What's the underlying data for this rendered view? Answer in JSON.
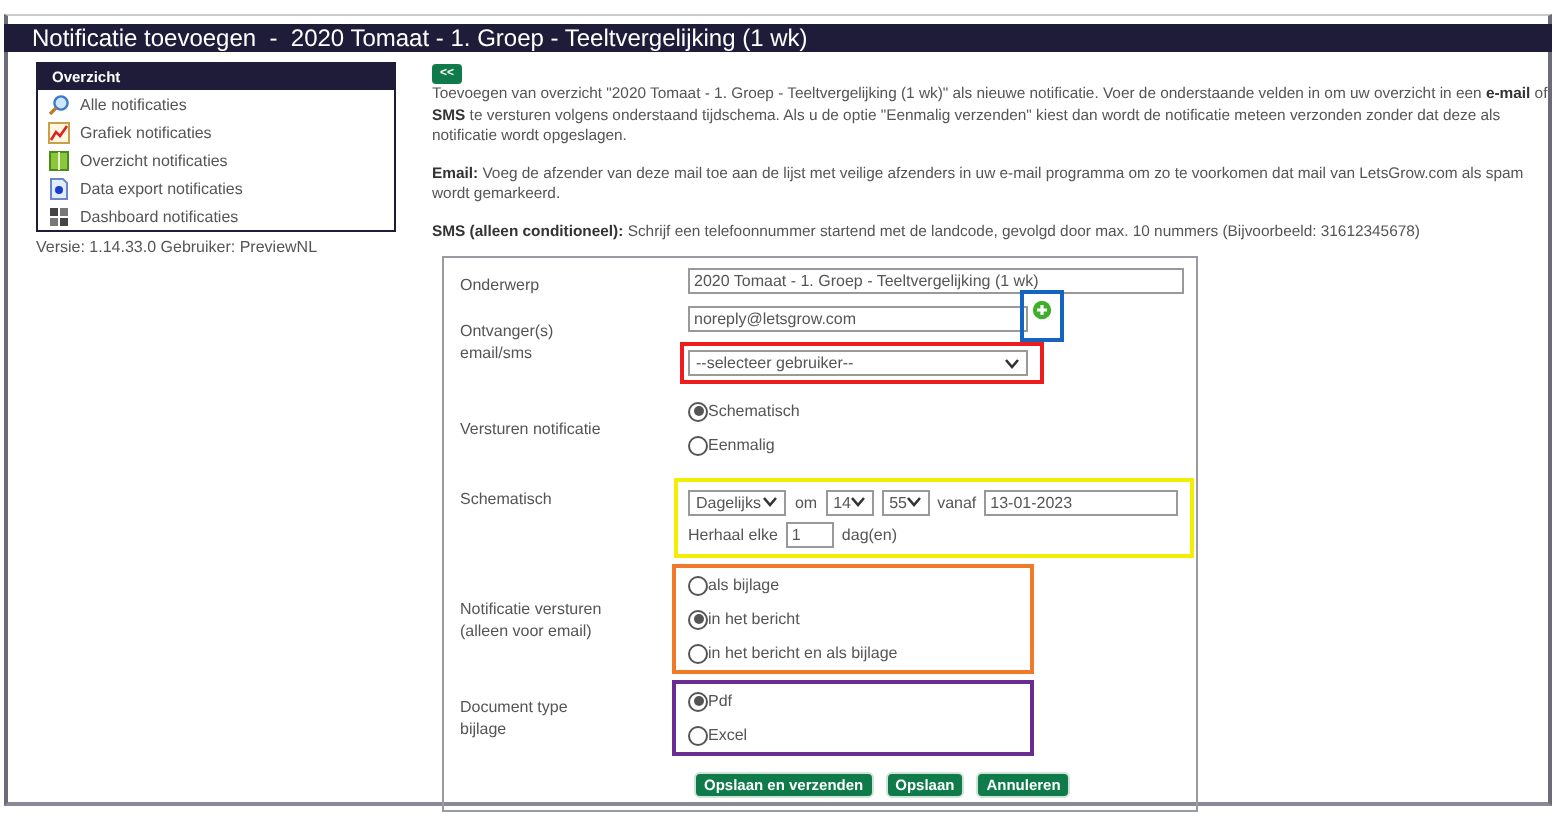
{
  "title": "Notificatie toevoegen  -  2020 Tomaat - 1. Groep - Teeltvergelijking (1 wk)",
  "sidebar": {
    "header": "Overzicht",
    "items": [
      {
        "label": "Alle notificaties"
      },
      {
        "label": "Grafiek notificaties"
      },
      {
        "label": "Overzicht notificaties"
      },
      {
        "label": "Data export notificaties"
      },
      {
        "label": "Dashboard notificaties"
      }
    ],
    "version": "Versie: 1.14.33.0 Gebruiker: PreviewNL"
  },
  "back_button": "<<",
  "intro": [
    "Toevoegen van overzicht \"2020 Tomaat - 1. Groep - Teeltvergelijking (1 wk)\" als nieuwe notificatie. Voer de onderstaande velden in om uw overzicht in een **e-mail** of **SMS** te versturen volgens onderstaand tijdschema. Als u de optie \"Eenmalig verzenden\" kiest dan wordt de notificatie meteen verzonden zonder dat deze als notificatie wordt opgeslagen.",
    "**Email:** Voeg de afzender van deze mail toe aan de lijst met veilige afzenders in uw e-mail programma om zo te voorkomen dat mail van LetsGrow.com als spam wordt gemarkeerd.",
    "**SMS (alleen conditioneel):** Schrijf een telefoonnummer startend met de landcode, gevolgd door max. 10 nummers (Bijvoorbeeld: 31612345678)"
  ],
  "form": {
    "rows": [
      {
        "kind": "text",
        "label": "Onderwerp",
        "value": "2020 Tomaat - 1. Groep - Teeltvergelijking (1 wk)"
      },
      {
        "kind": "recipients",
        "label": "Ontvanger(s)\nemail/sms",
        "value": "noreply@letsgrow.com",
        "add_button": {
          "color": "#1565c0"
        },
        "select": {
          "text": "--selecteer gebruiker--",
          "color": "#ee1c1c"
        }
      },
      {
        "kind": "radio",
        "label": "Versturen notificatie",
        "options": [
          {
            "label": "Schematisch",
            "selected": true
          },
          {
            "label": "Eenmalig",
            "selected": false
          }
        ]
      },
      {
        "kind": "schedule",
        "label": "Schematisch",
        "color": "#f2f000",
        "frequency": "Dagelijks",
        "at": "om",
        "hour": "14",
        "minute": "55",
        "from": "vanaf",
        "date": "13-01-2023",
        "repeat_label": "Herhaal elke",
        "repeat": "1",
        "unit": "dag(en)"
      },
      {
        "kind": "radio",
        "label": "Notificatie versturen\n(alleen voor email)",
        "color": "#f07a2a",
        "options": [
          {
            "label": "als bijlage",
            "selected": false
          },
          {
            "label": "in het bericht",
            "selected": true
          },
          {
            "label": "in het bericht en als bijlage",
            "selected": false
          }
        ]
      },
      {
        "kind": "radio",
        "label": "Document type\nbijlage",
        "color": "#6a2c91",
        "options": [
          {
            "label": "Pdf",
            "selected": true
          },
          {
            "label": "Excel",
            "selected": false
          }
        ]
      }
    ],
    "buttons": [
      "Opslaan en verzenden",
      "Opslaan",
      "Annuleren"
    ]
  }
}
